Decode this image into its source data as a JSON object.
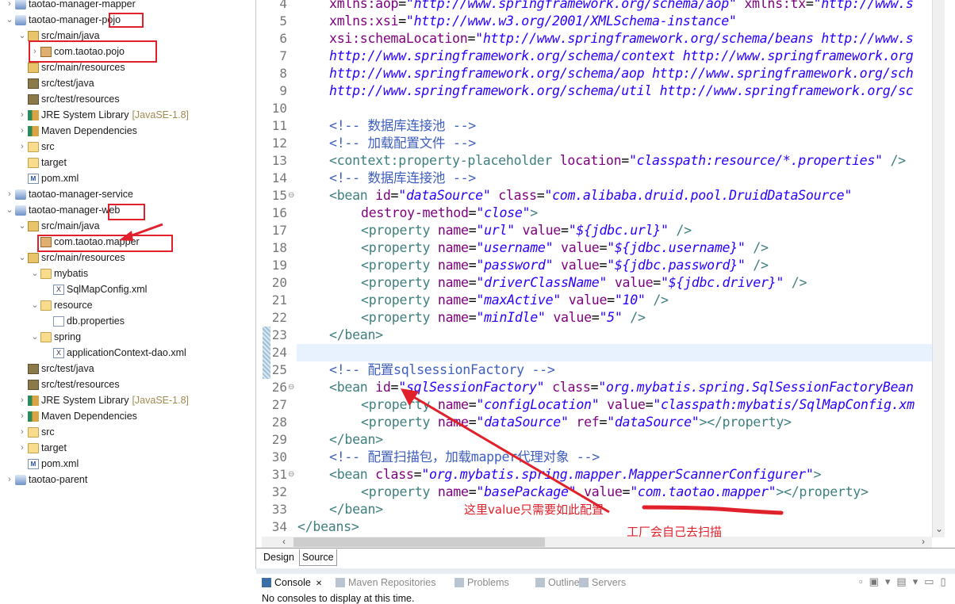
{
  "sidebar": {
    "rows": [
      {
        "level": 0,
        "arrow": ">",
        "icon": "project",
        "label": "taotao-manager-mapper"
      },
      {
        "level": 0,
        "arrow": "v",
        "icon": "project",
        "label": "taotao-manager-pojo"
      },
      {
        "level": 1,
        "arrow": "v",
        "icon": "source-folder",
        "label": "src/main/java"
      },
      {
        "level": 2,
        "arrow": ">",
        "icon": "package",
        "label": "com.taotao.pojo"
      },
      {
        "level": 1,
        "arrow": "",
        "icon": "source-folder",
        "label": "src/main/resources"
      },
      {
        "level": 1,
        "arrow": "",
        "icon": "test-source-folder",
        "label": "src/test/java"
      },
      {
        "level": 1,
        "arrow": "",
        "icon": "test-source-folder",
        "label": "src/test/resources"
      },
      {
        "level": 1,
        "arrow": ">",
        "icon": "library",
        "label": "JRE System Library",
        "deco": "[JavaSE-1.8]"
      },
      {
        "level": 1,
        "arrow": ">",
        "icon": "library",
        "label": "Maven Dependencies"
      },
      {
        "level": 1,
        "arrow": ">",
        "icon": "folder",
        "label": "src"
      },
      {
        "level": 1,
        "arrow": "",
        "icon": "folder",
        "label": "target"
      },
      {
        "level": 1,
        "arrow": "",
        "icon": "pom",
        "label": "pom.xml"
      },
      {
        "level": 0,
        "arrow": ">",
        "icon": "project",
        "label": "taotao-manager-service"
      },
      {
        "level": 0,
        "arrow": "v",
        "icon": "project",
        "label": "taotao-manager-web"
      },
      {
        "level": 1,
        "arrow": "v",
        "icon": "source-folder",
        "label": "src/main/java"
      },
      {
        "level": 2,
        "arrow": "",
        "icon": "package",
        "label": "com.taotao.mapper"
      },
      {
        "level": 1,
        "arrow": "v",
        "icon": "source-folder",
        "label": "src/main/resources"
      },
      {
        "level": 2,
        "arrow": "v",
        "icon": "folder",
        "label": "mybatis"
      },
      {
        "level": 3,
        "arrow": "",
        "icon": "xml-file",
        "label": "SqlMapConfig.xml"
      },
      {
        "level": 2,
        "arrow": "v",
        "icon": "folder",
        "label": "resource"
      },
      {
        "level": 3,
        "arrow": "",
        "icon": "text-file",
        "label": "db.properties"
      },
      {
        "level": 2,
        "arrow": "v",
        "icon": "folder",
        "label": "spring"
      },
      {
        "level": 3,
        "arrow": "",
        "icon": "xml-file",
        "label": "applicationContext-dao.xml"
      },
      {
        "level": 1,
        "arrow": "",
        "icon": "test-source-folder",
        "label": "src/test/java"
      },
      {
        "level": 1,
        "arrow": "",
        "icon": "test-source-folder",
        "label": "src/test/resources"
      },
      {
        "level": 1,
        "arrow": ">",
        "icon": "library",
        "label": "JRE System Library",
        "deco": "[JavaSE-1.8]"
      },
      {
        "level": 1,
        "arrow": ">",
        "icon": "library",
        "label": "Maven Dependencies"
      },
      {
        "level": 1,
        "arrow": ">",
        "icon": "folder",
        "label": "src"
      },
      {
        "level": 1,
        "arrow": ">",
        "icon": "folder",
        "label": "target"
      },
      {
        "level": 1,
        "arrow": "",
        "icon": "pom",
        "label": "pom.xml"
      },
      {
        "level": 0,
        "arrow": ">",
        "icon": "project",
        "label": "taotao-parent"
      }
    ]
  },
  "editor": {
    "current_line": 24,
    "lines": [
      {
        "n": 4,
        "indent": 1,
        "t": [
          [
            "attr",
            "xmlns:aop"
          ],
          [
            "pl",
            "="
          ],
          [
            "val",
            "\"http://www.springframework.org/schema/aop\""
          ],
          [
            "pl",
            " "
          ],
          [
            "attr",
            "xmlns:tx"
          ],
          [
            "pl",
            "="
          ],
          [
            "val",
            "\"http://www.s"
          ]
        ]
      },
      {
        "n": 5,
        "indent": 1,
        "t": [
          [
            "attr",
            "xmlns:xsi"
          ],
          [
            "pl",
            "="
          ],
          [
            "val",
            "\"http://www.w3.org/2001/XMLSchema-instance\""
          ]
        ]
      },
      {
        "n": 6,
        "indent": 1,
        "t": [
          [
            "attr",
            "xsi:schemaLocation"
          ],
          [
            "pl",
            "="
          ],
          [
            "val",
            "\"http://www.springframework.org/schema/beans http://www.s"
          ]
        ]
      },
      {
        "n": 7,
        "indent": 1,
        "t": [
          [
            "val",
            "http://www.springframework.org/schema/context http://www.springframework.org"
          ]
        ]
      },
      {
        "n": 8,
        "indent": 1,
        "t": [
          [
            "val",
            "http://www.springframework.org/schema/aop http://www.springframework.org/sch"
          ]
        ]
      },
      {
        "n": 9,
        "indent": 1,
        "t": [
          [
            "val",
            "http://www.springframework.org/schema/util http://www.springframework.org/sc"
          ]
        ]
      },
      {
        "n": 10,
        "indent": 0,
        "t": []
      },
      {
        "n": 11,
        "indent": 1,
        "t": [
          [
            "com",
            "<!-- 数据库连接池 -->"
          ]
        ]
      },
      {
        "n": 12,
        "indent": 1,
        "t": [
          [
            "com",
            "<!-- 加载配置文件 -->"
          ]
        ]
      },
      {
        "n": 13,
        "indent": 1,
        "t": [
          [
            "tag",
            "<context:property-placeholder"
          ],
          [
            "pl",
            " "
          ],
          [
            "attr",
            "location"
          ],
          [
            "pl",
            "="
          ],
          [
            "val",
            "\"classpath:resource/*.properties\""
          ],
          [
            "pl",
            " "
          ],
          [
            "tag",
            "/>"
          ]
        ]
      },
      {
        "n": 14,
        "indent": 1,
        "t": [
          [
            "com",
            "<!-- 数据库连接池 -->"
          ]
        ]
      },
      {
        "n": 15,
        "indent": 1,
        "fold": true,
        "t": [
          [
            "tag",
            "<bean"
          ],
          [
            "pl",
            " "
          ],
          [
            "attr",
            "id"
          ],
          [
            "pl",
            "="
          ],
          [
            "val",
            "\"dataSource\""
          ],
          [
            "pl",
            " "
          ],
          [
            "attr",
            "class"
          ],
          [
            "pl",
            "="
          ],
          [
            "val",
            "\"com.alibaba.druid.pool.DruidDataSource\""
          ]
        ]
      },
      {
        "n": 16,
        "indent": 2,
        "t": [
          [
            "attr",
            "destroy-method"
          ],
          [
            "pl",
            "="
          ],
          [
            "val",
            "\"close\""
          ],
          [
            "tag",
            ">"
          ]
        ]
      },
      {
        "n": 17,
        "indent": 2,
        "t": [
          [
            "tag",
            "<property"
          ],
          [
            "pl",
            " "
          ],
          [
            "attr",
            "name"
          ],
          [
            "pl",
            "="
          ],
          [
            "val",
            "\"url\""
          ],
          [
            "pl",
            " "
          ],
          [
            "attr",
            "value"
          ],
          [
            "pl",
            "="
          ],
          [
            "val",
            "\"${jdbc.url}\""
          ],
          [
            "pl",
            " "
          ],
          [
            "tag",
            "/>"
          ]
        ]
      },
      {
        "n": 18,
        "indent": 2,
        "t": [
          [
            "tag",
            "<property"
          ],
          [
            "pl",
            " "
          ],
          [
            "attr",
            "name"
          ],
          [
            "pl",
            "="
          ],
          [
            "val",
            "\"username\""
          ],
          [
            "pl",
            " "
          ],
          [
            "attr",
            "value"
          ],
          [
            "pl",
            "="
          ],
          [
            "val",
            "\"${jdbc.username}\""
          ],
          [
            "pl",
            " "
          ],
          [
            "tag",
            "/>"
          ]
        ]
      },
      {
        "n": 19,
        "indent": 2,
        "t": [
          [
            "tag",
            "<property"
          ],
          [
            "pl",
            " "
          ],
          [
            "attr",
            "name"
          ],
          [
            "pl",
            "="
          ],
          [
            "val",
            "\"password\""
          ],
          [
            "pl",
            " "
          ],
          [
            "attr",
            "value"
          ],
          [
            "pl",
            "="
          ],
          [
            "val",
            "\"${jdbc.password}\""
          ],
          [
            "pl",
            " "
          ],
          [
            "tag",
            "/>"
          ]
        ]
      },
      {
        "n": 20,
        "indent": 2,
        "t": [
          [
            "tag",
            "<property"
          ],
          [
            "pl",
            " "
          ],
          [
            "attr",
            "name"
          ],
          [
            "pl",
            "="
          ],
          [
            "val",
            "\"driverClassName\""
          ],
          [
            "pl",
            " "
          ],
          [
            "attr",
            "value"
          ],
          [
            "pl",
            "="
          ],
          [
            "val",
            "\"${jdbc.driver}\""
          ],
          [
            "pl",
            " "
          ],
          [
            "tag",
            "/>"
          ]
        ]
      },
      {
        "n": 21,
        "indent": 2,
        "t": [
          [
            "tag",
            "<property"
          ],
          [
            "pl",
            " "
          ],
          [
            "attr",
            "name"
          ],
          [
            "pl",
            "="
          ],
          [
            "val",
            "\"maxActive\""
          ],
          [
            "pl",
            " "
          ],
          [
            "attr",
            "value"
          ],
          [
            "pl",
            "="
          ],
          [
            "val",
            "\"10\""
          ],
          [
            "pl",
            " "
          ],
          [
            "tag",
            "/>"
          ]
        ]
      },
      {
        "n": 22,
        "indent": 2,
        "t": [
          [
            "tag",
            "<property"
          ],
          [
            "pl",
            " "
          ],
          [
            "attr",
            "name"
          ],
          [
            "pl",
            "="
          ],
          [
            "val",
            "\"minIdle\""
          ],
          [
            "pl",
            " "
          ],
          [
            "attr",
            "value"
          ],
          [
            "pl",
            "="
          ],
          [
            "val",
            "\"5\""
          ],
          [
            "pl",
            " "
          ],
          [
            "tag",
            "/>"
          ]
        ]
      },
      {
        "n": 23,
        "indent": 1,
        "t": [
          [
            "tag",
            "</bean>"
          ]
        ]
      },
      {
        "n": 24,
        "indent": 0,
        "t": []
      },
      {
        "n": 25,
        "indent": 1,
        "t": [
          [
            "com",
            "<!-- 配置sqlsessionFactory -->"
          ]
        ]
      },
      {
        "n": 26,
        "indent": 1,
        "fold": true,
        "t": [
          [
            "tag",
            "<bean"
          ],
          [
            "pl",
            " "
          ],
          [
            "attr",
            "id"
          ],
          [
            "pl",
            "="
          ],
          [
            "val",
            "\"sqlSessionFactory\""
          ],
          [
            "pl",
            " "
          ],
          [
            "attr",
            "class"
          ],
          [
            "pl",
            "="
          ],
          [
            "val",
            "\"org.mybatis.spring.SqlSessionFactoryBean"
          ]
        ]
      },
      {
        "n": 27,
        "indent": 2,
        "t": [
          [
            "tag",
            "<property"
          ],
          [
            "pl",
            " "
          ],
          [
            "attr",
            "name"
          ],
          [
            "pl",
            "="
          ],
          [
            "val",
            "\"configLocation\""
          ],
          [
            "pl",
            " "
          ],
          [
            "attr",
            "value"
          ],
          [
            "pl",
            "="
          ],
          [
            "val",
            "\"classpath:mybatis/SqlMapConfig.xm"
          ]
        ]
      },
      {
        "n": 28,
        "indent": 2,
        "t": [
          [
            "tag",
            "<property"
          ],
          [
            "pl",
            " "
          ],
          [
            "attr",
            "name"
          ],
          [
            "pl",
            "="
          ],
          [
            "val",
            "\"dataSource\""
          ],
          [
            "pl",
            " "
          ],
          [
            "attr",
            "ref"
          ],
          [
            "pl",
            "="
          ],
          [
            "val",
            "\"dataSource\""
          ],
          [
            "tag",
            "></property>"
          ]
        ]
      },
      {
        "n": 29,
        "indent": 1,
        "t": [
          [
            "tag",
            "</bean>"
          ]
        ]
      },
      {
        "n": 30,
        "indent": 1,
        "t": [
          [
            "com",
            "<!-- 配置扫描包，加载mapper代理对象 -->"
          ]
        ]
      },
      {
        "n": 31,
        "indent": 1,
        "fold": true,
        "t": [
          [
            "tag",
            "<bean"
          ],
          [
            "pl",
            " "
          ],
          [
            "attr",
            "class"
          ],
          [
            "pl",
            "="
          ],
          [
            "val",
            "\"org.mybatis.spring.mapper.MapperScannerConfigurer\""
          ],
          [
            "tag",
            ">"
          ]
        ]
      },
      {
        "n": 32,
        "indent": 2,
        "t": [
          [
            "tag",
            "<property"
          ],
          [
            "pl",
            " "
          ],
          [
            "attr",
            "name"
          ],
          [
            "pl",
            "="
          ],
          [
            "val",
            "\"basePackage\""
          ],
          [
            "pl",
            " "
          ],
          [
            "attr",
            "value"
          ],
          [
            "pl",
            "="
          ],
          [
            "val",
            "\"com.taotao.mapper\""
          ],
          [
            "tag",
            "></property>"
          ]
        ]
      },
      {
        "n": 33,
        "indent": 1,
        "t": [
          [
            "tag",
            "</bean>"
          ]
        ]
      },
      {
        "n": 34,
        "indent": 0,
        "t": [
          [
            "tag",
            "</beans>"
          ]
        ]
      }
    ]
  },
  "annotations": {
    "note1": "这里value只需要如此配置",
    "note2": "工厂会自己去扫描",
    "color": "#e0202a"
  },
  "editor_tabs": {
    "design": "Design",
    "source": "Source",
    "active": "Source"
  },
  "console_tabs": [
    {
      "label": "Console",
      "icon": "console-icon",
      "active": true,
      "close": "✕"
    },
    {
      "label": "Maven Repositories",
      "icon": "maven-repo-icon"
    },
    {
      "label": "Problems",
      "icon": "problems-icon"
    },
    {
      "label": "Outline",
      "icon": "outline-icon"
    },
    {
      "label": "Servers",
      "icon": "servers-icon"
    }
  ],
  "console": {
    "message": "No consoles to display at this time."
  },
  "syntax_colors": {
    "tag": "#3f7f7f",
    "attr": "#7f007f",
    "value": "#2a00ff",
    "comment": "#3f5fbf"
  }
}
